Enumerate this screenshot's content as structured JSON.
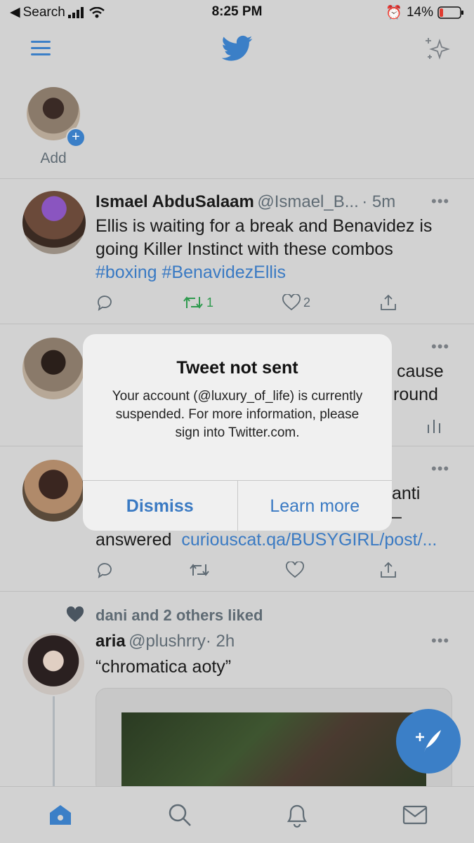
{
  "status": {
    "carrier": "Search",
    "time": "8:25 PM",
    "battery": "14%"
  },
  "stories": {
    "add_label": "Add"
  },
  "tweets": [
    {
      "name": "Ismael AbduSalaam",
      "handle": "@Ismael_B...",
      "time": "· 5m",
      "text": "Ellis is waiting for a break and Benavidez is going Killer Instinct with these combos",
      "hashtags": "#boxing #BenavidezEllis",
      "retweets": "1",
      "likes": "2"
    },
    {
      "partial1": "cause",
      "partial2": "round"
    },
    {
      "partial1": "anti",
      "partial2": "–",
      "answered": "answered",
      "link": "curiouscat.qa/BUSYGIRL/post/..."
    },
    {
      "social": "dani and 2 others liked",
      "name": "aria",
      "handle": "@plushrry",
      "time": "· 2h",
      "text": "“chromatica aoty”"
    }
  ],
  "dialog": {
    "title": "Tweet not sent",
    "message": "Your account (@luxury_of_life) is currently suspended. For more information, please sign into Twitter.com.",
    "dismiss": "Dismiss",
    "learn_more": "Learn more"
  },
  "icons": {
    "menu": "hamburger-icon",
    "logo": "twitter-bird-icon",
    "sparkle": "sparkle-icon",
    "tabs": [
      "home-icon",
      "search-icon",
      "bell-icon",
      "mail-icon"
    ],
    "compose": "compose-icon"
  },
  "colors": {
    "accent": "#3b7fc7",
    "retweet": "#2e9a4e",
    "bg": "#d2d2d2"
  }
}
